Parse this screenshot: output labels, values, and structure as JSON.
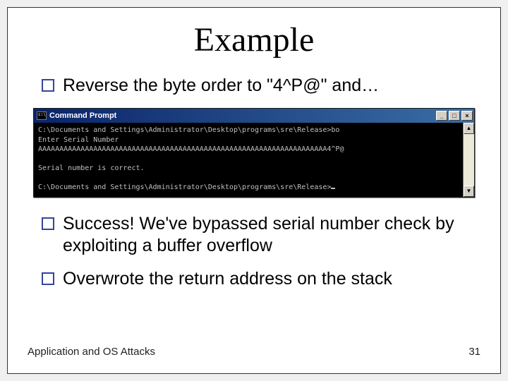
{
  "title": "Example",
  "bullets": {
    "b1": "Reverse the byte order to \"4^P@\" and…",
    "b2": "Success! We've bypassed serial number check by exploiting a buffer overflow",
    "b3": "Overwrote the return address on the stack"
  },
  "cmd": {
    "window_title": "Command Prompt",
    "lines": {
      "l1": "C:\\Documents and Settings\\Administrator\\Desktop\\programs\\sre\\Release>bo",
      "l2": "Enter Serial Number",
      "l3": "AAAAAAAAAAAAAAAAAAAAAAAAAAAAAAAAAAAAAAAAAAAAAAAAAAAAAAAAAAAAAAAAAAAA4^P@",
      "l4": "Serial number is correct.",
      "l5": "C:\\Documents and Settings\\Administrator\\Desktop\\programs\\sre\\Release>"
    },
    "buttons": {
      "min": "_",
      "max": "□",
      "close": "×"
    },
    "scroll": {
      "up": "▲",
      "down": "▼"
    }
  },
  "footer": {
    "left": "Application and OS Attacks",
    "right": "31"
  }
}
